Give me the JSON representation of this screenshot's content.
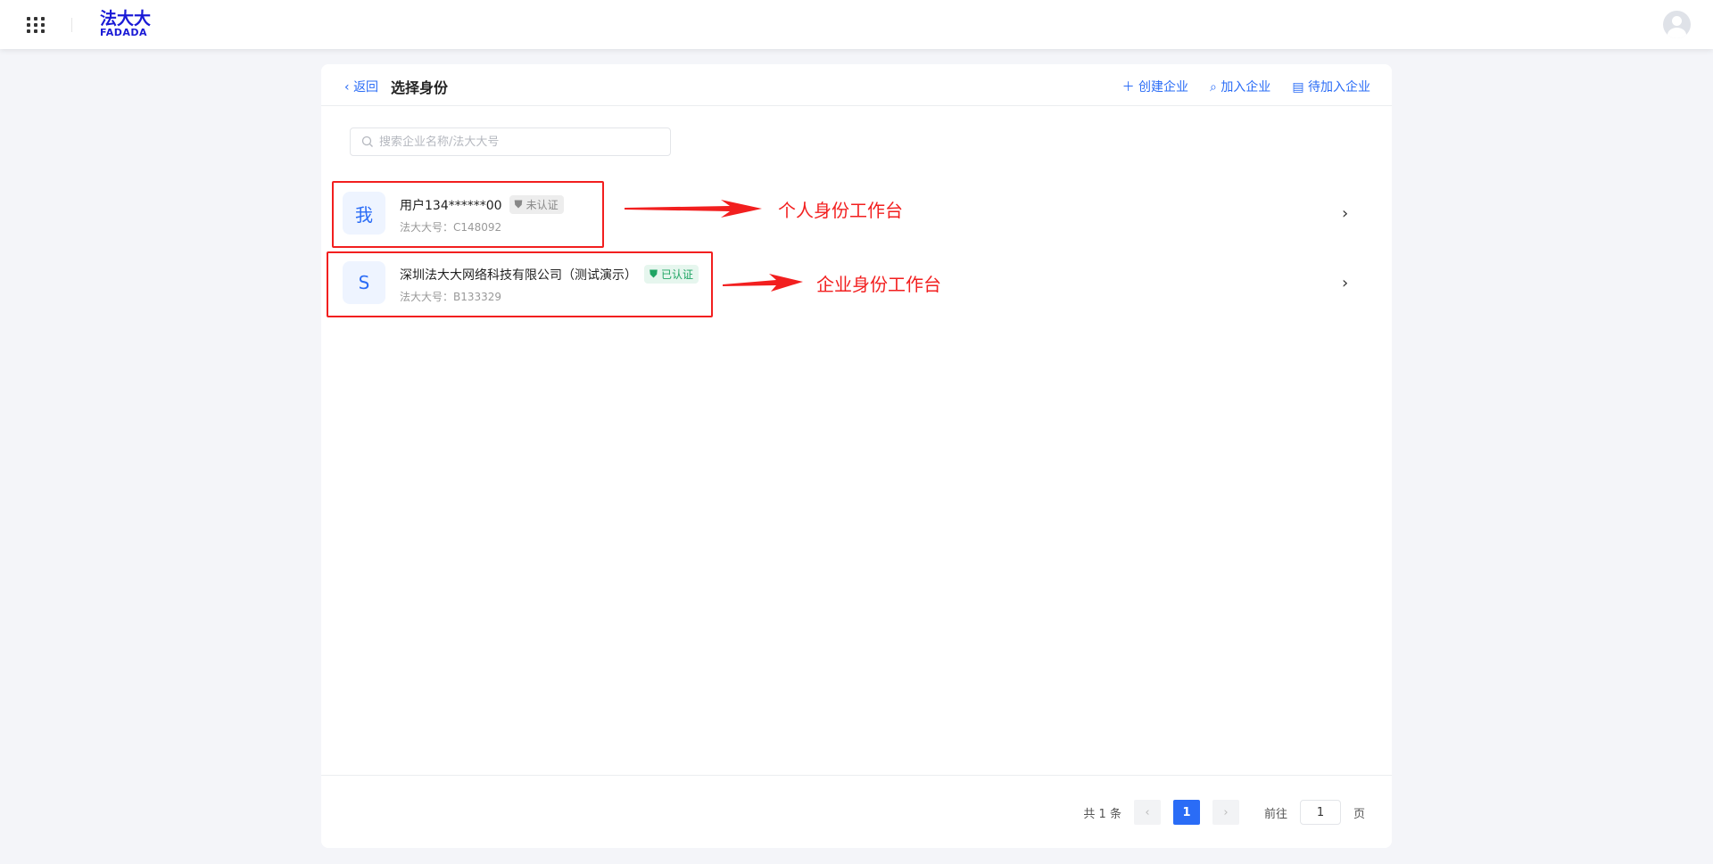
{
  "header": {
    "logo_cn": "法大大",
    "logo_en": "FADADA"
  },
  "card": {
    "back_label": "返回",
    "title": "选择身份",
    "actions": [
      {
        "icon": "plus-icon",
        "label": "创建企业"
      },
      {
        "icon": "search-icon",
        "label": "加入企业"
      },
      {
        "icon": "document-icon",
        "label": "待加入企业"
      }
    ],
    "search_placeholder": "搜索企业名称/法大大号",
    "identities": [
      {
        "avatar": "我",
        "name": "用户134******00",
        "badge": "未认证",
        "sub": "法大大号：C148092",
        "annotation": "个人身份工作台"
      },
      {
        "avatar": "S",
        "name": "深圳法大大网络科技有限公司（测试演示）",
        "badge": "已认证",
        "sub": "法大大号：B133329",
        "annotation": "企业身份工作台"
      }
    ],
    "pagination": {
      "total": "共 1 条",
      "current": "1",
      "goto_label": "前往",
      "goto_value": "1",
      "page_suffix": "页"
    }
  },
  "colors": {
    "accent": "#2a6cf6",
    "annotation": "#f21f1f",
    "verified": "#1fa564"
  }
}
